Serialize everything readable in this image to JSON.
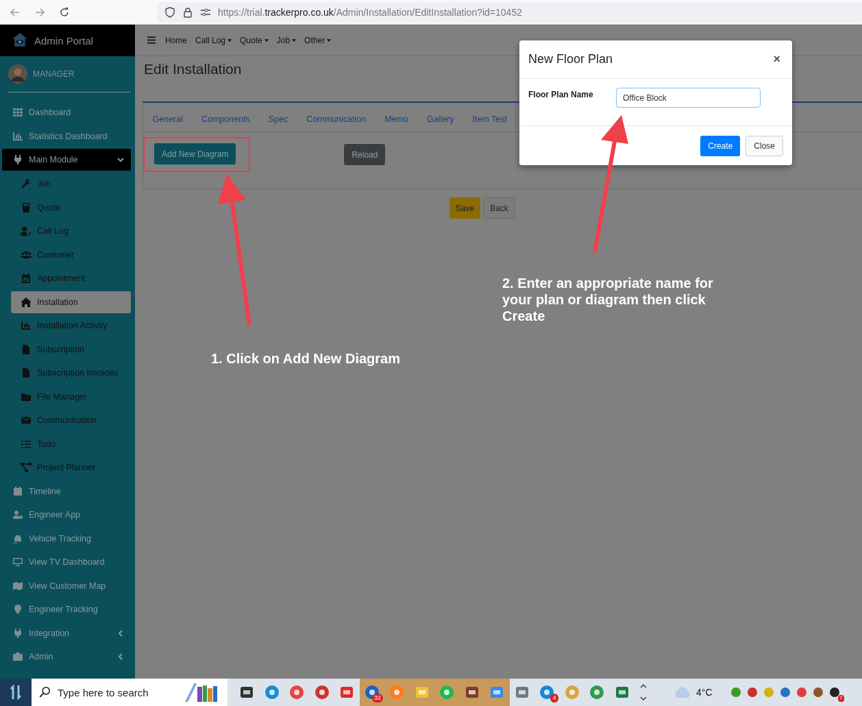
{
  "browser": {
    "url_prefix": "https://trial.",
    "url_domain": "trackerpro.co.uk",
    "url_path": "/Admin/Installation/EditInstallation?id=10452"
  },
  "sidebar": {
    "brand": "Admin Portal",
    "user": "MANAGER",
    "items": [
      {
        "label": "Dashboard",
        "kind": "top",
        "selected": false
      },
      {
        "label": "Statistics Dashboard",
        "kind": "top",
        "selected": false
      },
      {
        "label": "Main Module",
        "kind": "group",
        "expanded": true,
        "children": [
          {
            "label": "Job",
            "selected": false
          },
          {
            "label": "Quote",
            "selected": false
          },
          {
            "label": "Call Log",
            "selected": false
          },
          {
            "label": "Customer",
            "selected": false
          },
          {
            "label": "Appointment",
            "selected": false
          },
          {
            "label": "Installation",
            "selected": true
          },
          {
            "label": "Installation Activity",
            "selected": false
          },
          {
            "label": "Subscription",
            "selected": false
          },
          {
            "label": "Subscription Invoices",
            "selected": false
          },
          {
            "label": "File Manager",
            "selected": false
          },
          {
            "label": "Communication",
            "selected": false
          },
          {
            "label": "Todo",
            "selected": false
          },
          {
            "label": "Project Planner",
            "selected": false
          }
        ]
      },
      {
        "label": "Timeline",
        "kind": "top",
        "selected": false
      },
      {
        "label": "Engineer App",
        "kind": "top",
        "selected": false
      },
      {
        "label": "Vehicle Tracking",
        "kind": "top",
        "selected": false
      },
      {
        "label": "View TV Dashboard",
        "kind": "top",
        "selected": false
      },
      {
        "label": "View Customer Map",
        "kind": "top",
        "selected": false
      },
      {
        "label": "Engineer Tracking",
        "kind": "top",
        "selected": false
      },
      {
        "label": "Integration",
        "kind": "group",
        "expanded": false
      },
      {
        "label": "Admin",
        "kind": "group",
        "expanded": false
      }
    ]
  },
  "navbar": {
    "items": [
      {
        "label": "Home",
        "dropdown": false
      },
      {
        "label": "Call Log",
        "dropdown": true
      },
      {
        "label": "Quote",
        "dropdown": true
      },
      {
        "label": "Job",
        "dropdown": true
      },
      {
        "label": "Other",
        "dropdown": true
      }
    ]
  },
  "page": {
    "title": "Edit Installation",
    "tabs": [
      {
        "label": "General",
        "selected": false
      },
      {
        "label": "Components",
        "selected": false
      },
      {
        "label": "Spec",
        "selected": false
      },
      {
        "label": "Communication",
        "selected": false
      },
      {
        "label": "Memo",
        "selected": false
      },
      {
        "label": "Gallery",
        "selected": false
      },
      {
        "label": "Item Test",
        "selected": false
      }
    ],
    "add_button": "Add New Diagram",
    "reload_button": "Reload",
    "save_button": "Save",
    "back_button": "Back"
  },
  "annotations": [
    "1. Click on Add New Diagram",
    "2. Enter an appropriate name for your plan or diagram then click Create"
  ],
  "modal": {
    "title": "New Floor Plan",
    "close": "×",
    "field_label": "Floor Plan Name",
    "field_value": "Office Block",
    "create_button": "Create",
    "close_button": "Close"
  },
  "taskbar": {
    "search_placeholder": "Type here to search",
    "apps": [
      {
        "active": false
      },
      {
        "active": false
      },
      {
        "active": false
      },
      {
        "active": false
      },
      {
        "active": false
      },
      {
        "active": true,
        "badge": "32"
      },
      {
        "active": true
      },
      {
        "active": true
      },
      {
        "active": true
      },
      {
        "active": true
      },
      {
        "active": true
      },
      {
        "active": false
      },
      {
        "active": false,
        "badge": "4"
      },
      {
        "active": false
      },
      {
        "active": false
      },
      {
        "active": false
      }
    ],
    "weather": "4°C",
    "tray_badge": "7"
  }
}
